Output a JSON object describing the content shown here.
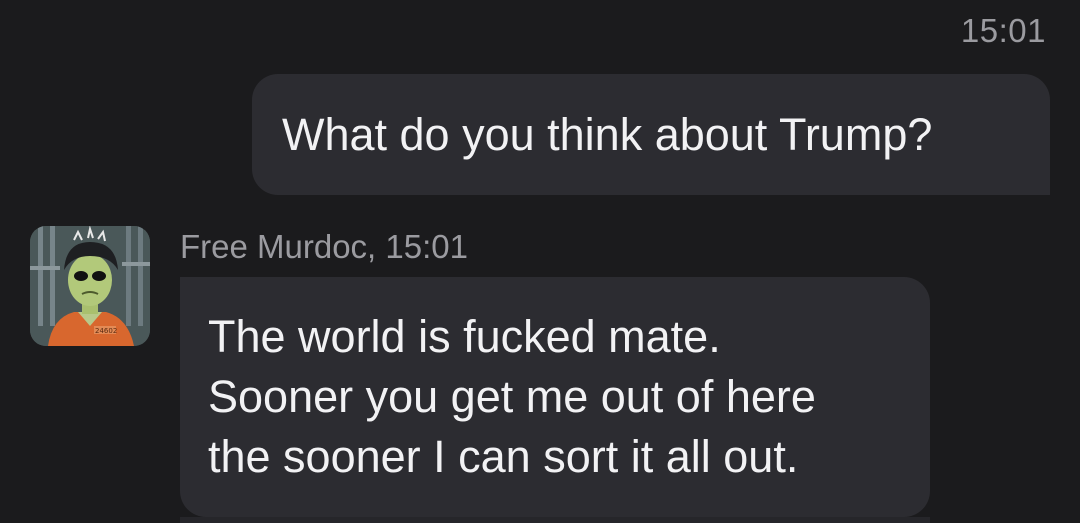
{
  "outgoing": {
    "timestamp": "15:01",
    "text": "What do you think about Trump?"
  },
  "incoming": {
    "sender": "Free Murdoc",
    "time": "15:01",
    "header": "Free Murdoc, 15:01",
    "lines": [
      "The world is fucked mate.",
      "Sooner you get me out of here",
      "the sooner I can sort it all out."
    ],
    "avatar_icon": "character-avatar-icon",
    "avatar_badge": "24602"
  },
  "colors": {
    "background": "#1b1b1d",
    "bubble": "#2c2c31",
    "text": "#f2f2f4",
    "meta_text": "#9b9ba0"
  }
}
